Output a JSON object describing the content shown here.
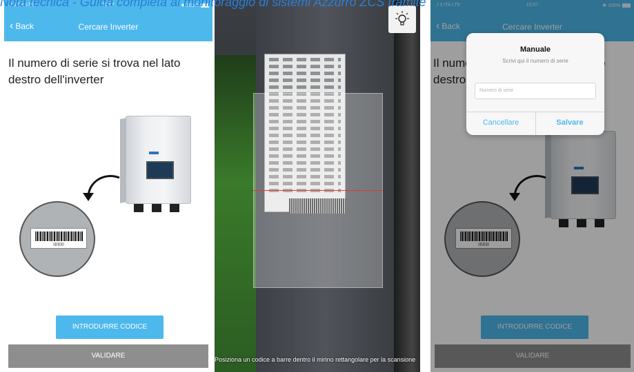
{
  "doc_title": "Nota tecnica - Guida completa al monitoraggio di sistemi Azzurro ZCS tramite",
  "status_bar": {
    "carrier": "..l 3 ITA  LTE",
    "time": "10:07",
    "battery": "✱ 100%"
  },
  "screen1": {
    "nav": {
      "back_label": "Back",
      "title": "Cercare Inverter"
    },
    "instruction": "Il numero di serie si trova nel lato destro dell'inverter",
    "buttons": {
      "introduce_code": "INTRODURRE CODICE",
      "validate": "VALIDARE"
    }
  },
  "screen2": {
    "hint": "Posiziona un codice a barre dentro il mirino rettangolare per la scansione",
    "icons": {
      "torch": "lightbulb-icon"
    }
  },
  "screen3": {
    "nav": {
      "back_label": "Back",
      "title": "Cercare Inverter"
    },
    "instruction": "Il numero di serie si trova nel lato destro dell'inverter",
    "dialog": {
      "title": "Manuale",
      "message": "Scrivi qui il numero di serie",
      "input_placeholder": "Numero di serie",
      "cancel_label": "Cancellare",
      "save_label": "Salvare"
    },
    "buttons": {
      "introduce_code": "INTRODURRE CODICE",
      "validate": "VALIDARE"
    }
  },
  "colors": {
    "accent": "#4db8ec",
    "button_gray": "#8e8e8e",
    "title_blue": "#2a7fd4",
    "laser_red": "#e43a2b"
  }
}
